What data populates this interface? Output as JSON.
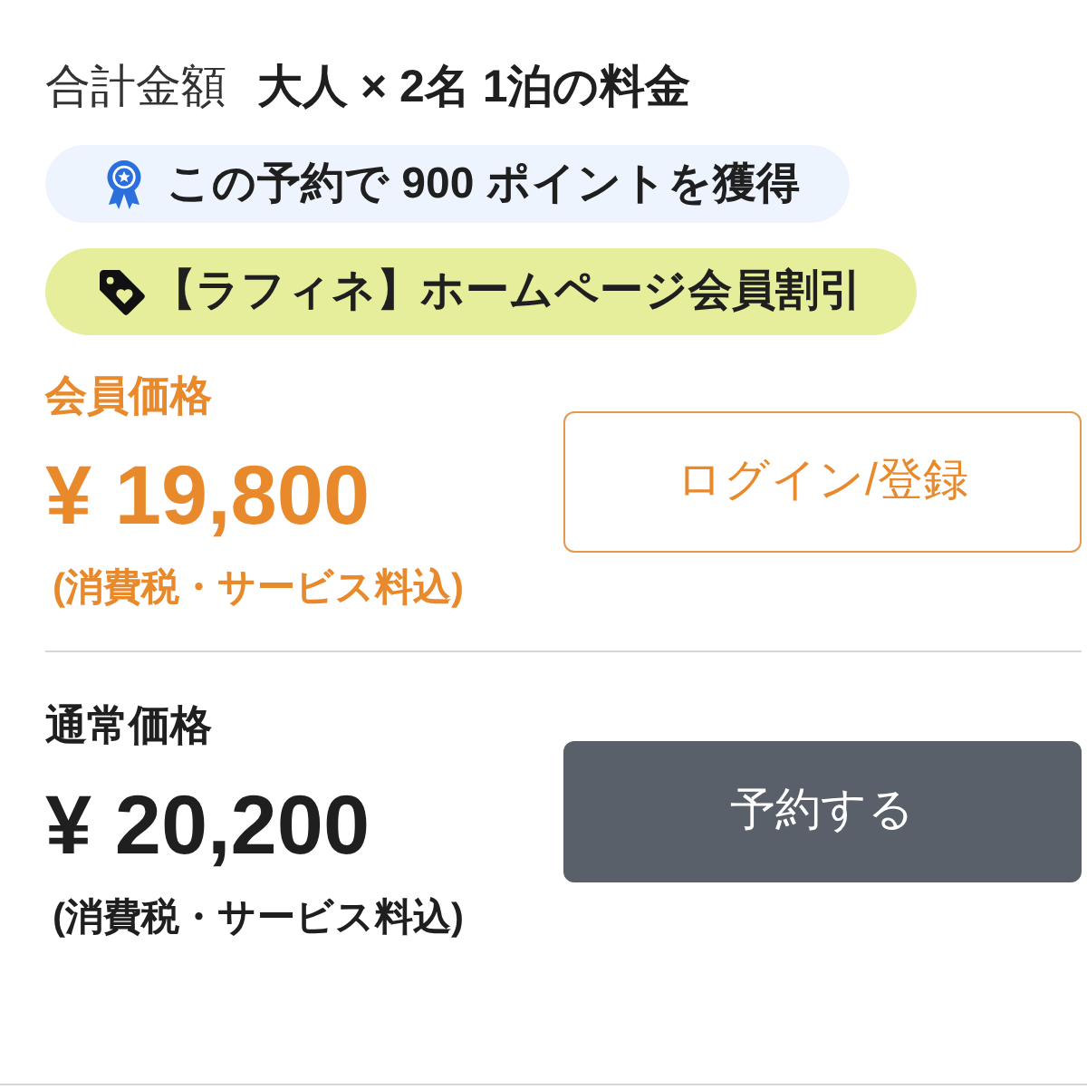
{
  "total": {
    "label": "合計金額",
    "description": "大人 × 2名 1泊の料金"
  },
  "badges": [
    {
      "kind": "points",
      "text": "この予約で 900 ポイントを獲得"
    },
    {
      "kind": "discount",
      "text": "【ラフィネ】ホームページ会員割引"
    }
  ],
  "prices": [
    {
      "kind": "member",
      "label": "会員価格",
      "amount": "¥ 19,800",
      "note": "(消費税・サービス料込)",
      "button": "ログイン/登録"
    },
    {
      "kind": "regular",
      "label": "通常価格",
      "amount": "¥ 20,200",
      "note": "(消費税・サービス料込)",
      "button": "予約する"
    }
  ]
}
